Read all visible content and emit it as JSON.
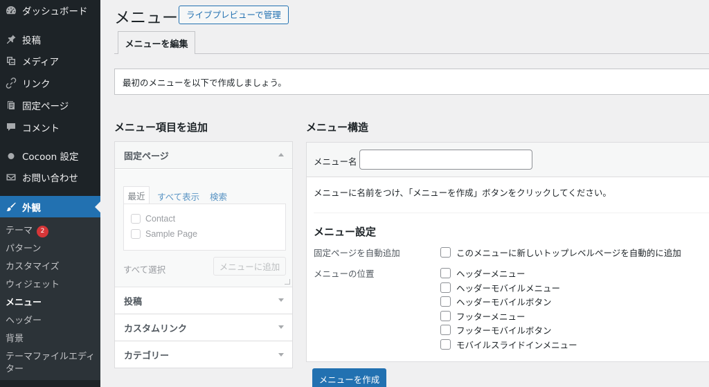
{
  "sidebar": {
    "items": [
      {
        "label": "ダッシュボード",
        "icon": "dashboard-icon"
      },
      {
        "label": "投稿",
        "icon": "pin-icon"
      },
      {
        "label": "メディア",
        "icon": "media-icon"
      },
      {
        "label": "リンク",
        "icon": "link-icon"
      },
      {
        "label": "固定ページ",
        "icon": "page-icon"
      },
      {
        "label": "コメント",
        "icon": "comment-icon"
      },
      {
        "label": "Cocoon 設定",
        "icon": "circle-icon"
      },
      {
        "label": "お問い合わせ",
        "icon": "mail-icon"
      },
      {
        "label": "外観",
        "icon": "brush-icon"
      }
    ],
    "submenu": [
      {
        "label": "テーマ"
      },
      {
        "label": "パターン"
      },
      {
        "label": "カスタマイズ"
      },
      {
        "label": "ウィジェット"
      },
      {
        "label": "メニュー"
      },
      {
        "label": "ヘッダー"
      },
      {
        "label": "背景"
      },
      {
        "label": "テーマファイルエディ"
      },
      {
        "label": "ター"
      }
    ],
    "theme_badge": "2"
  },
  "header": {
    "title": "メニュー",
    "live_preview_button": "ライブプレビューで管理"
  },
  "tabs": {
    "edit": "メニューを編集"
  },
  "notice": "最初のメニューを以下で作成しましょう。",
  "add_items": {
    "heading": "メニュー項目を追加",
    "pages": {
      "title": "固定ページ",
      "tabs": {
        "recent": "最近",
        "all": "すべて表示",
        "search": "検索"
      },
      "items": [
        "Contact",
        "Sample Page"
      ],
      "select_all": "すべて選択",
      "add_button": "メニューに追加"
    },
    "sections": [
      "投稿",
      "カスタムリンク",
      "カテゴリー"
    ]
  },
  "structure": {
    "heading": "メニュー構造",
    "menu_name_label": "メニュー名",
    "menu_name_value": "",
    "instruction": "メニューに名前をつけ、「メニューを作成」ボタンをクリックしてください。",
    "settings_heading": "メニュー設定",
    "auto_add_label": "固定ページを自動追加",
    "auto_add_option": "このメニューに新しいトップレベルページを自動的に追加",
    "location_label": "メニューの位置",
    "locations": [
      "ヘッダーメニュー",
      "ヘッダーモバイルメニュー",
      "ヘッダーモバイルボタン",
      "フッターメニュー",
      "フッターモバイルボタン",
      "モバイルスライドインメニュー"
    ],
    "create_button": "メニューを作成"
  },
  "colors": {
    "admin_bar": "#1d2327",
    "accent": "#2271b1",
    "badge": "#d63638"
  }
}
